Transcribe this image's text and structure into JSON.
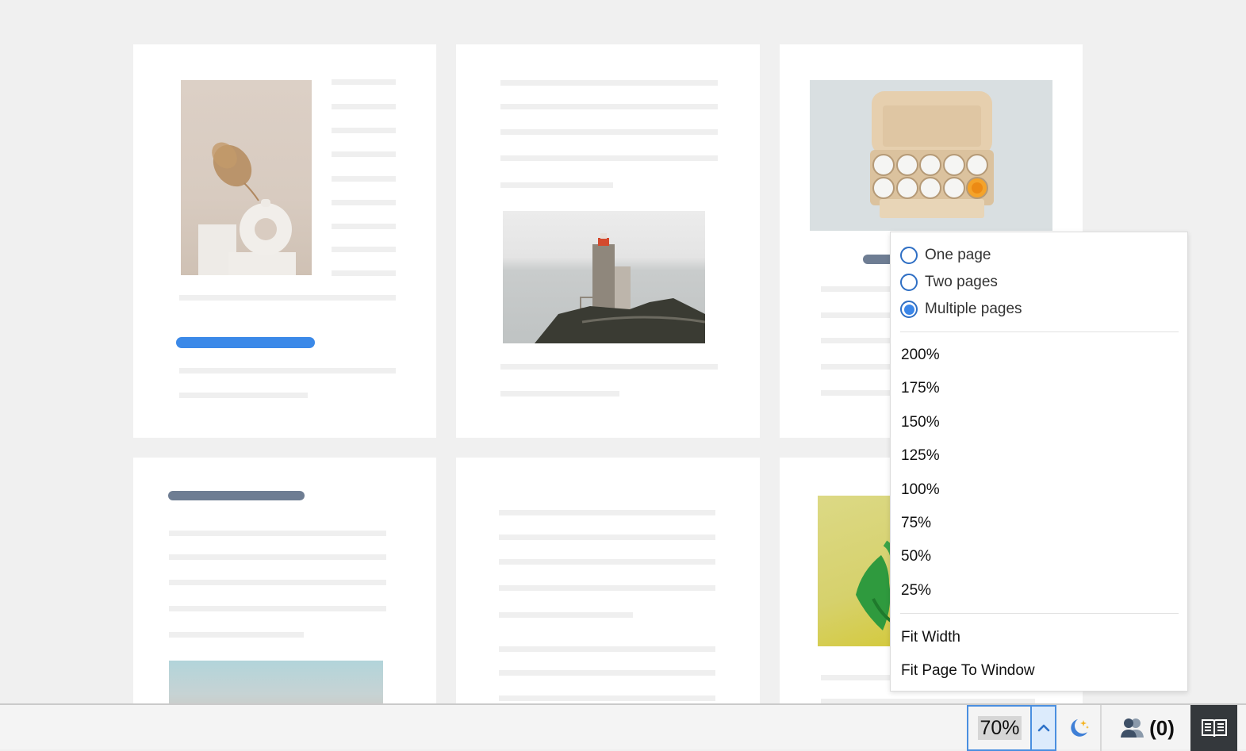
{
  "document": {
    "pages": [
      {
        "name": "page-1",
        "image": "vase-with-pampas-grass-photo"
      },
      {
        "name": "page-2",
        "image": "lighthouse-photo"
      },
      {
        "name": "page-3",
        "image": "egg-carton-photo"
      },
      {
        "name": "page-4",
        "image": "sky-photo"
      },
      {
        "name": "page-5",
        "image": ""
      },
      {
        "name": "page-6",
        "image": "green-plant-photo"
      }
    ]
  },
  "view_menu": {
    "layout_options": [
      {
        "label": "One page",
        "selected": false
      },
      {
        "label": "Two pages",
        "selected": false
      },
      {
        "label": "Multiple pages",
        "selected": true
      }
    ],
    "zoom_levels": [
      "200%",
      "175%",
      "150%",
      "125%",
      "100%",
      "75%",
      "50%",
      "25%"
    ],
    "fit_options": [
      "Fit Width",
      "Fit Page To Window"
    ]
  },
  "statusbar": {
    "zoom_value": "70%",
    "zoom_toggle_icon": "chevron-up-icon",
    "night_mode_icon": "moon-stars-icon",
    "users_icon": "users-icon",
    "users_count": "(0)",
    "reader_icon": "open-book-icon"
  },
  "colors": {
    "accent": "#3b89e8",
    "heading_bar": "#6e7d93",
    "reader_button_bg": "#34383c"
  }
}
